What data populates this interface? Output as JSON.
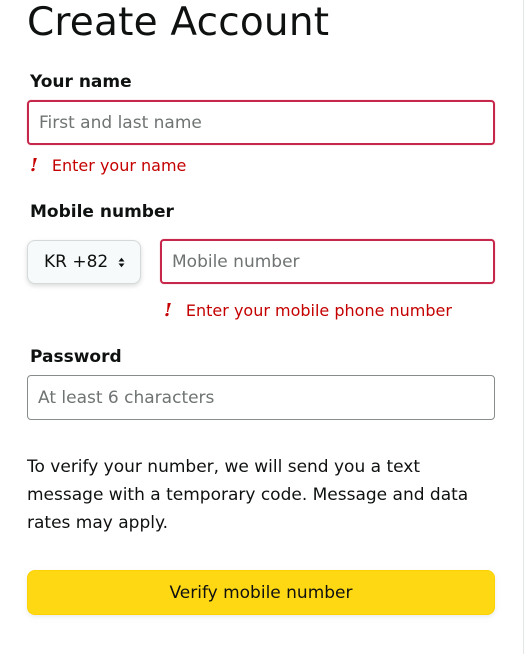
{
  "form": {
    "title": "Create Account",
    "name": {
      "label": "Your name",
      "placeholder": "First and last name",
      "value": "",
      "error": "Enter your name"
    },
    "mobile": {
      "label": "Mobile number",
      "country_code": "KR +82",
      "placeholder": "Mobile number",
      "value": "",
      "error": "Enter your mobile phone number"
    },
    "password": {
      "label": "Password",
      "placeholder": "At least 6 characters",
      "value": ""
    },
    "info_text": "To verify your number, we will send you a text message with a temporary code. Message and data rates may apply.",
    "verify_button": "Verify mobile number"
  },
  "colors": {
    "error_border": "#c7274a",
    "error_text": "#c40000",
    "button_bg": "#ffd814"
  },
  "icons": {
    "error": "exclamation-icon",
    "country_select": "up-down-chevron-icon"
  }
}
